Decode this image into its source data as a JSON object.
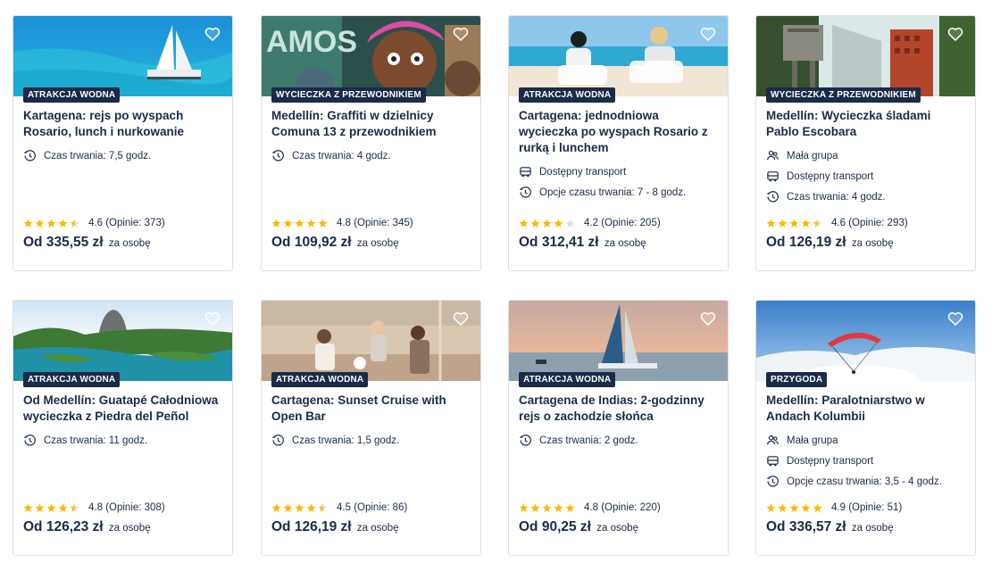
{
  "colors": {
    "navy": "#1a2b49",
    "star": "#ffb800",
    "star_empty": "#dcdfe4",
    "border": "#dcdfe4"
  },
  "cards": [
    {
      "badge": "ATRAKCJA WODNA",
      "title": "Kartagena: rejs po wyspach Rosario, lunch i nurkowanie",
      "features": [
        {
          "icon": "clock-icon",
          "text": "Czas trwania: 7,5 godz."
        }
      ],
      "stars": 4.5,
      "rating": "4.6",
      "reviews": "(Opinie: 373)",
      "price": "Od 335,55 zł",
      "per": "za osobę"
    },
    {
      "badge": "WYCIECZKA Z PRZEWODNIKIEM",
      "title": "Medellín: Graffiti w dzielnicy Comuna 13 z przewodnikiem",
      "features": [
        {
          "icon": "clock-icon",
          "text": "Czas trwania: 4 godz."
        }
      ],
      "stars": 5,
      "rating": "4.8",
      "reviews": "(Opinie: 345)",
      "price": "Od 109,92 zł",
      "per": "za osobę"
    },
    {
      "badge": "ATRAKCJA WODNA",
      "title": "Cartagena: jednodniowa wycieczka po wyspach Rosario z rurką i lunchem",
      "features": [
        {
          "icon": "bus-icon",
          "text": "Dostępny transport"
        },
        {
          "icon": "clock-icon",
          "text": "Opcje czasu trwania: 7 - 8 godz."
        }
      ],
      "stars": 4,
      "rating": "4.2",
      "reviews": "(Opinie: 205)",
      "price": "Od 312,41 zł",
      "per": "za osobę"
    },
    {
      "badge": "WYCIECZKA Z PRZEWODNIKIEM",
      "title": "Medellín: Wycieczka śladami Pablo Escobara",
      "features": [
        {
          "icon": "group-icon",
          "text": "Mała grupa"
        },
        {
          "icon": "bus-icon",
          "text": "Dostępny transport"
        },
        {
          "icon": "clock-icon",
          "text": "Czas trwania: 4 godz."
        }
      ],
      "stars": 4.5,
      "rating": "4.6",
      "reviews": "(Opinie: 293)",
      "price": "Od 126,19 zł",
      "per": "za osobę"
    },
    {
      "badge": "ATRAKCJA WODNA",
      "title": "Od Medellín: Guatapé Całodniowa wycieczka z Piedra del Peñol",
      "features": [
        {
          "icon": "clock-icon",
          "text": "Czas trwania: 11 godz."
        }
      ],
      "stars": 4.5,
      "rating": "4.8",
      "reviews": "(Opinie: 308)",
      "price": "Od 126,23 zł",
      "per": "za osobę"
    },
    {
      "badge": "ATRAKCJA WODNA",
      "title": "Cartagena: Sunset Cruise with Open Bar",
      "features": [
        {
          "icon": "clock-icon",
          "text": "Czas trwania: 1,5 godz."
        }
      ],
      "stars": 4.5,
      "rating": "4.5",
      "reviews": "(Opinie: 86)",
      "price": "Od 126,19 zł",
      "per": "za osobę"
    },
    {
      "badge": "ATRAKCJA WODNA",
      "title": "Cartagena de Indias: 2-godzinny rejs o zachodzie słońca",
      "features": [
        {
          "icon": "clock-icon",
          "text": "Czas trwania: 2 godz."
        }
      ],
      "stars": 5,
      "rating": "4.8",
      "reviews": "(Opinie: 220)",
      "price": "Od 90,25 zł",
      "per": "za osobę"
    },
    {
      "badge": "PRZYGODA",
      "title": "Medellín: Paralotniarstwo w Andach Kolumbii",
      "features": [
        {
          "icon": "group-icon",
          "text": "Mała grupa"
        },
        {
          "icon": "bus-icon",
          "text": "Dostępny transport"
        },
        {
          "icon": "clock-icon",
          "text": "Opcje czasu trwania: 3,5 - 4 godz."
        }
      ],
      "stars": 5,
      "rating": "4.9",
      "reviews": "(Opinie: 51)",
      "price": "Od 336,57 zł",
      "per": "za osobę"
    }
  ]
}
